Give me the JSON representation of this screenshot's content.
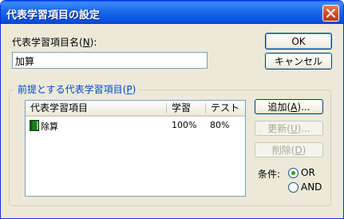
{
  "window": {
    "title": "代表学習項目の設定",
    "close_icon": "close-icon"
  },
  "name_field": {
    "label_prefix": "代表学習項目名(",
    "label_key": "N",
    "label_suffix": "):",
    "value": "加算"
  },
  "buttons": {
    "ok": "OK",
    "cancel": "キャンセル",
    "add_prefix": "追加(",
    "add_key": "A",
    "add_suffix": ")...",
    "update_prefix": "更新(",
    "update_key": "U",
    "update_suffix": ")...",
    "delete_prefix": "削除(",
    "delete_key": "D",
    "delete_suffix": ")"
  },
  "prereq_group": {
    "title_prefix": "前提とする代表学習項目(",
    "title_key": "P",
    "title_suffix": ")",
    "columns": [
      "代表学習項目",
      "学習",
      "テスト"
    ],
    "rows": [
      {
        "name": "除算",
        "study": "100%",
        "test": "80%",
        "icon": "book-icon"
      }
    ]
  },
  "condition": {
    "label": "条件:",
    "options": [
      {
        "label": "OR",
        "selected": true
      },
      {
        "label": "AND",
        "selected": false
      }
    ]
  }
}
